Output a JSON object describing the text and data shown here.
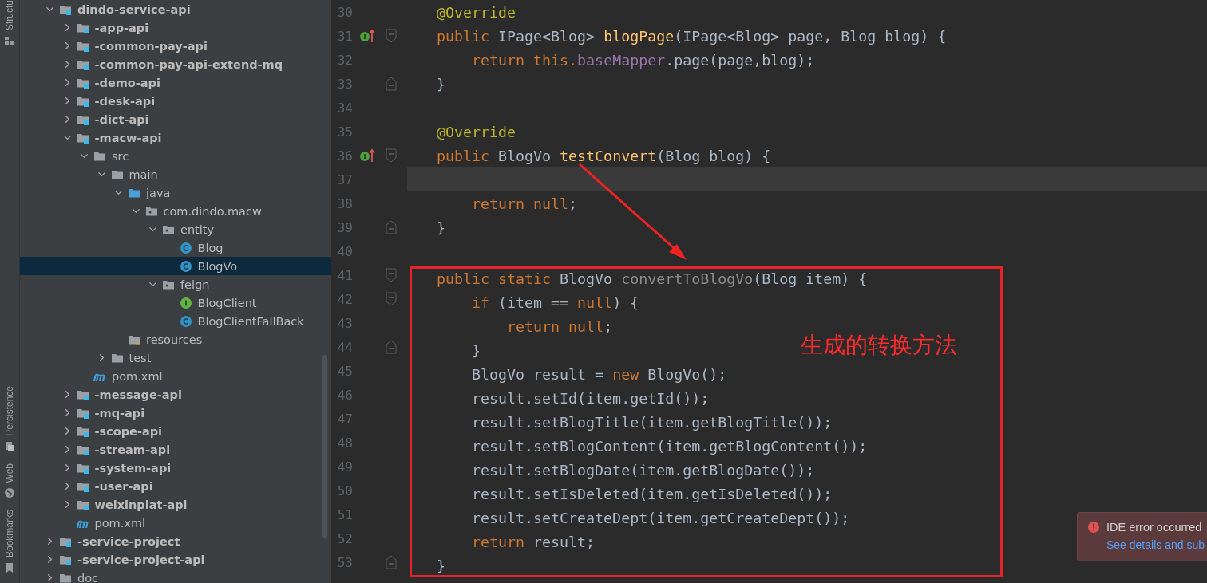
{
  "tool_strip": {
    "top": [
      {
        "kind": "structure",
        "label": "Structu"
      }
    ],
    "bottom": [
      {
        "kind": "persistence",
        "label": "Persistence"
      },
      {
        "kind": "web",
        "label": "Web"
      },
      {
        "kind": "bookmarks",
        "label": "Bookmarks"
      }
    ]
  },
  "project_tree": [
    {
      "label": "dindo-service-api",
      "kind": "module",
      "expanded": true,
      "selected": false,
      "children": [
        {
          "label": "-app-api",
          "kind": "module",
          "expanded": false,
          "selected": false
        },
        {
          "label": "-common-pay-api",
          "kind": "module",
          "expanded": false,
          "selected": false
        },
        {
          "label": "-common-pay-api-extend-mq",
          "kind": "module",
          "expanded": false,
          "selected": false
        },
        {
          "label": "-demo-api",
          "kind": "module",
          "expanded": false,
          "selected": false
        },
        {
          "label": "-desk-api",
          "kind": "module",
          "expanded": false,
          "selected": false
        },
        {
          "label": "-dict-api",
          "kind": "module",
          "expanded": false,
          "selected": false
        },
        {
          "label": "-macw-api",
          "kind": "module",
          "expanded": true,
          "selected": false,
          "children": [
            {
              "label": "src",
              "kind": "folder",
              "expanded": true,
              "selected": false,
              "children": [
                {
                  "label": "main",
                  "kind": "folder",
                  "expanded": true,
                  "selected": false,
                  "children": [
                    {
                      "label": "java",
                      "kind": "source-folder",
                      "expanded": true,
                      "selected": false,
                      "children": [
                        {
                          "label": "com.dindo.macw",
                          "kind": "package",
                          "expanded": true,
                          "selected": false,
                          "children": [
                            {
                              "label": "entity",
                              "kind": "package",
                              "expanded": true,
                              "selected": false,
                              "children": [
                                {
                                  "label": "Blog",
                                  "kind": "class",
                                  "selected": false
                                },
                                {
                                  "label": "BlogVo",
                                  "kind": "class",
                                  "selected": true
                                }
                              ]
                            },
                            {
                              "label": "feign",
                              "kind": "package",
                              "expanded": true,
                              "selected": false,
                              "children": [
                                {
                                  "label": "BlogClient",
                                  "kind": "interface",
                                  "selected": false
                                },
                                {
                                  "label": "BlogClientFallBack",
                                  "kind": "class",
                                  "selected": false
                                }
                              ]
                            }
                          ]
                        }
                      ]
                    },
                    {
                      "label": "resources",
                      "kind": "resources",
                      "selected": false
                    }
                  ]
                },
                {
                  "label": "test",
                  "kind": "folder",
                  "expanded": false,
                  "selected": false
                }
              ]
            },
            {
              "label": "pom.xml",
              "kind": "maven",
              "selected": false
            }
          ]
        },
        {
          "label": "-message-api",
          "kind": "module",
          "expanded": false,
          "selected": false
        },
        {
          "label": "-mq-api",
          "kind": "module",
          "expanded": false,
          "selected": false
        },
        {
          "label": "-scope-api",
          "kind": "module",
          "expanded": false,
          "selected": false
        },
        {
          "label": "-stream-api",
          "kind": "module",
          "expanded": false,
          "selected": false
        },
        {
          "label": "-system-api",
          "kind": "module",
          "expanded": false,
          "selected": false
        },
        {
          "label": "-user-api",
          "kind": "module",
          "expanded": false,
          "selected": false
        },
        {
          "label": "weixinplat-api",
          "kind": "module",
          "expanded": false,
          "selected": false
        },
        {
          "label": "pom.xml",
          "kind": "maven",
          "selected": false
        }
      ]
    },
    {
      "label": "-service-project",
      "kind": "module",
      "expanded": false,
      "selected": false
    },
    {
      "label": "-service-project-api",
      "kind": "module",
      "expanded": false,
      "selected": false
    },
    {
      "label": "doc",
      "kind": "folder",
      "expanded": false,
      "selected": false
    }
  ],
  "editor": {
    "annotation": {
      "text": "生成的转换方法"
    },
    "lines": [
      {
        "number": "30",
        "current": false,
        "boxed": false,
        "implements": false,
        "fold_start": false,
        "fold_end": false,
        "tokens": [
          {
            "kind": "annotation",
            "text": "@Override"
          }
        ]
      },
      {
        "number": "31",
        "current": false,
        "boxed": false,
        "implements": true,
        "fold_start": true,
        "fold_end": false,
        "tokens": [
          {
            "kind": "keyword",
            "text": "public "
          },
          {
            "kind": "plain",
            "text": "IPage<Blog> "
          },
          {
            "kind": "method",
            "text": "blogPage"
          },
          {
            "kind": "plain",
            "text": "(IPage<Blog> page, Blog blog) {"
          }
        ]
      },
      {
        "number": "32",
        "current": false,
        "boxed": false,
        "implements": false,
        "fold_start": false,
        "fold_end": false,
        "tokens": [
          {
            "kind": "keyword",
            "text": "    return this."
          },
          {
            "kind": "field",
            "text": "baseMapper"
          },
          {
            "kind": "plain",
            "text": ".page(page,blog);"
          }
        ]
      },
      {
        "number": "33",
        "current": false,
        "boxed": false,
        "implements": false,
        "fold_start": false,
        "fold_end": true,
        "tokens": [
          {
            "kind": "plain",
            "text": "}"
          }
        ]
      },
      {
        "number": "34",
        "current": false,
        "boxed": false,
        "implements": false,
        "fold_start": false,
        "fold_end": false
      },
      {
        "number": "35",
        "current": false,
        "boxed": false,
        "implements": false,
        "fold_start": false,
        "fold_end": false,
        "tokens": [
          {
            "kind": "annotation",
            "text": "@Override"
          }
        ]
      },
      {
        "number": "36",
        "current": false,
        "boxed": false,
        "implements": true,
        "fold_start": true,
        "fold_end": false,
        "tokens": [
          {
            "kind": "keyword",
            "text": "public "
          },
          {
            "kind": "plain",
            "text": "BlogVo "
          },
          {
            "kind": "method",
            "text": "testConvert"
          },
          {
            "kind": "plain",
            "text": "(Blog blog) {"
          }
        ]
      },
      {
        "number": "37",
        "current": true,
        "boxed": false,
        "implements": false,
        "fold_start": false,
        "fold_end": false
      },
      {
        "number": "38",
        "current": false,
        "boxed": false,
        "implements": false,
        "fold_start": false,
        "fold_end": false,
        "tokens": [
          {
            "kind": "keyword",
            "text": "    return null"
          },
          {
            "kind": "plain",
            "text": ";"
          }
        ]
      },
      {
        "number": "39",
        "current": false,
        "boxed": false,
        "implements": false,
        "fold_start": false,
        "fold_end": true,
        "tokens": [
          {
            "kind": "plain",
            "text": "}"
          }
        ]
      },
      {
        "number": "40",
        "current": false,
        "boxed": false,
        "implements": false,
        "fold_start": false,
        "fold_end": false
      },
      {
        "number": "41",
        "current": false,
        "boxed": true,
        "implements": false,
        "fold_start": true,
        "fold_end": false,
        "tokens": [
          {
            "kind": "keyword",
            "text": "public static "
          },
          {
            "kind": "plain",
            "text": "BlogVo "
          },
          {
            "kind": "unused",
            "text": "convertToBlogVo"
          },
          {
            "kind": "plain",
            "text": "(Blog item) {"
          }
        ]
      },
      {
        "number": "42",
        "current": false,
        "boxed": true,
        "implements": false,
        "fold_start": true,
        "fold_end": false,
        "tokens": [
          {
            "kind": "keyword",
            "text": "    if "
          },
          {
            "kind": "plain",
            "text": "(item == "
          },
          {
            "kind": "keyword",
            "text": "null"
          },
          {
            "kind": "plain",
            "text": ") {"
          }
        ]
      },
      {
        "number": "43",
        "current": false,
        "boxed": true,
        "implements": false,
        "fold_start": false,
        "fold_end": false,
        "tokens": [
          {
            "kind": "keyword",
            "text": "        return null"
          },
          {
            "kind": "plain",
            "text": ";"
          }
        ]
      },
      {
        "number": "44",
        "current": false,
        "boxed": true,
        "implements": false,
        "fold_start": false,
        "fold_end": true,
        "tokens": [
          {
            "kind": "plain",
            "text": "    }"
          }
        ]
      },
      {
        "number": "45",
        "current": false,
        "boxed": true,
        "implements": false,
        "fold_start": false,
        "fold_end": false,
        "tokens": [
          {
            "kind": "plain",
            "text": "    BlogVo result = "
          },
          {
            "kind": "keyword",
            "text": "new "
          },
          {
            "kind": "plain",
            "text": "BlogVo();"
          }
        ]
      },
      {
        "number": "46",
        "current": false,
        "boxed": true,
        "implements": false,
        "fold_start": false,
        "fold_end": false,
        "tokens": [
          {
            "kind": "plain",
            "text": "    result.setId(item.getId());"
          }
        ]
      },
      {
        "number": "47",
        "current": false,
        "boxed": true,
        "implements": false,
        "fold_start": false,
        "fold_end": false,
        "tokens": [
          {
            "kind": "plain",
            "text": "    result.setBlogTitle(item.getBlogTitle());"
          }
        ]
      },
      {
        "number": "48",
        "current": false,
        "boxed": true,
        "implements": false,
        "fold_start": false,
        "fold_end": false,
        "tokens": [
          {
            "kind": "plain",
            "text": "    result.setBlogContent(item.getBlogContent());"
          }
        ]
      },
      {
        "number": "49",
        "current": false,
        "boxed": true,
        "implements": false,
        "fold_start": false,
        "fold_end": false,
        "tokens": [
          {
            "kind": "plain",
            "text": "    result.setBlogDate(item.getBlogDate());"
          }
        ]
      },
      {
        "number": "50",
        "current": false,
        "boxed": true,
        "implements": false,
        "fold_start": false,
        "fold_end": false,
        "tokens": [
          {
            "kind": "plain",
            "text": "    result.setIsDeleted(item.getIsDeleted());"
          }
        ]
      },
      {
        "number": "51",
        "current": false,
        "boxed": true,
        "implements": false,
        "fold_start": false,
        "fold_end": false,
        "tokens": [
          {
            "kind": "plain",
            "text": "    result.setCreateDept(item.getCreateDept());"
          }
        ]
      },
      {
        "number": "52",
        "current": false,
        "boxed": true,
        "implements": false,
        "fold_start": false,
        "fold_end": false,
        "tokens": [
          {
            "kind": "keyword",
            "text": "    return "
          },
          {
            "kind": "plain",
            "text": "result;"
          }
        ]
      },
      {
        "number": "53",
        "current": false,
        "boxed": true,
        "implements": false,
        "fold_start": false,
        "fold_end": true,
        "tokens": [
          {
            "kind": "plain",
            "text": "}"
          }
        ]
      }
    ]
  },
  "notification": {
    "title": "IDE error occurred",
    "link": "See details and sub"
  }
}
